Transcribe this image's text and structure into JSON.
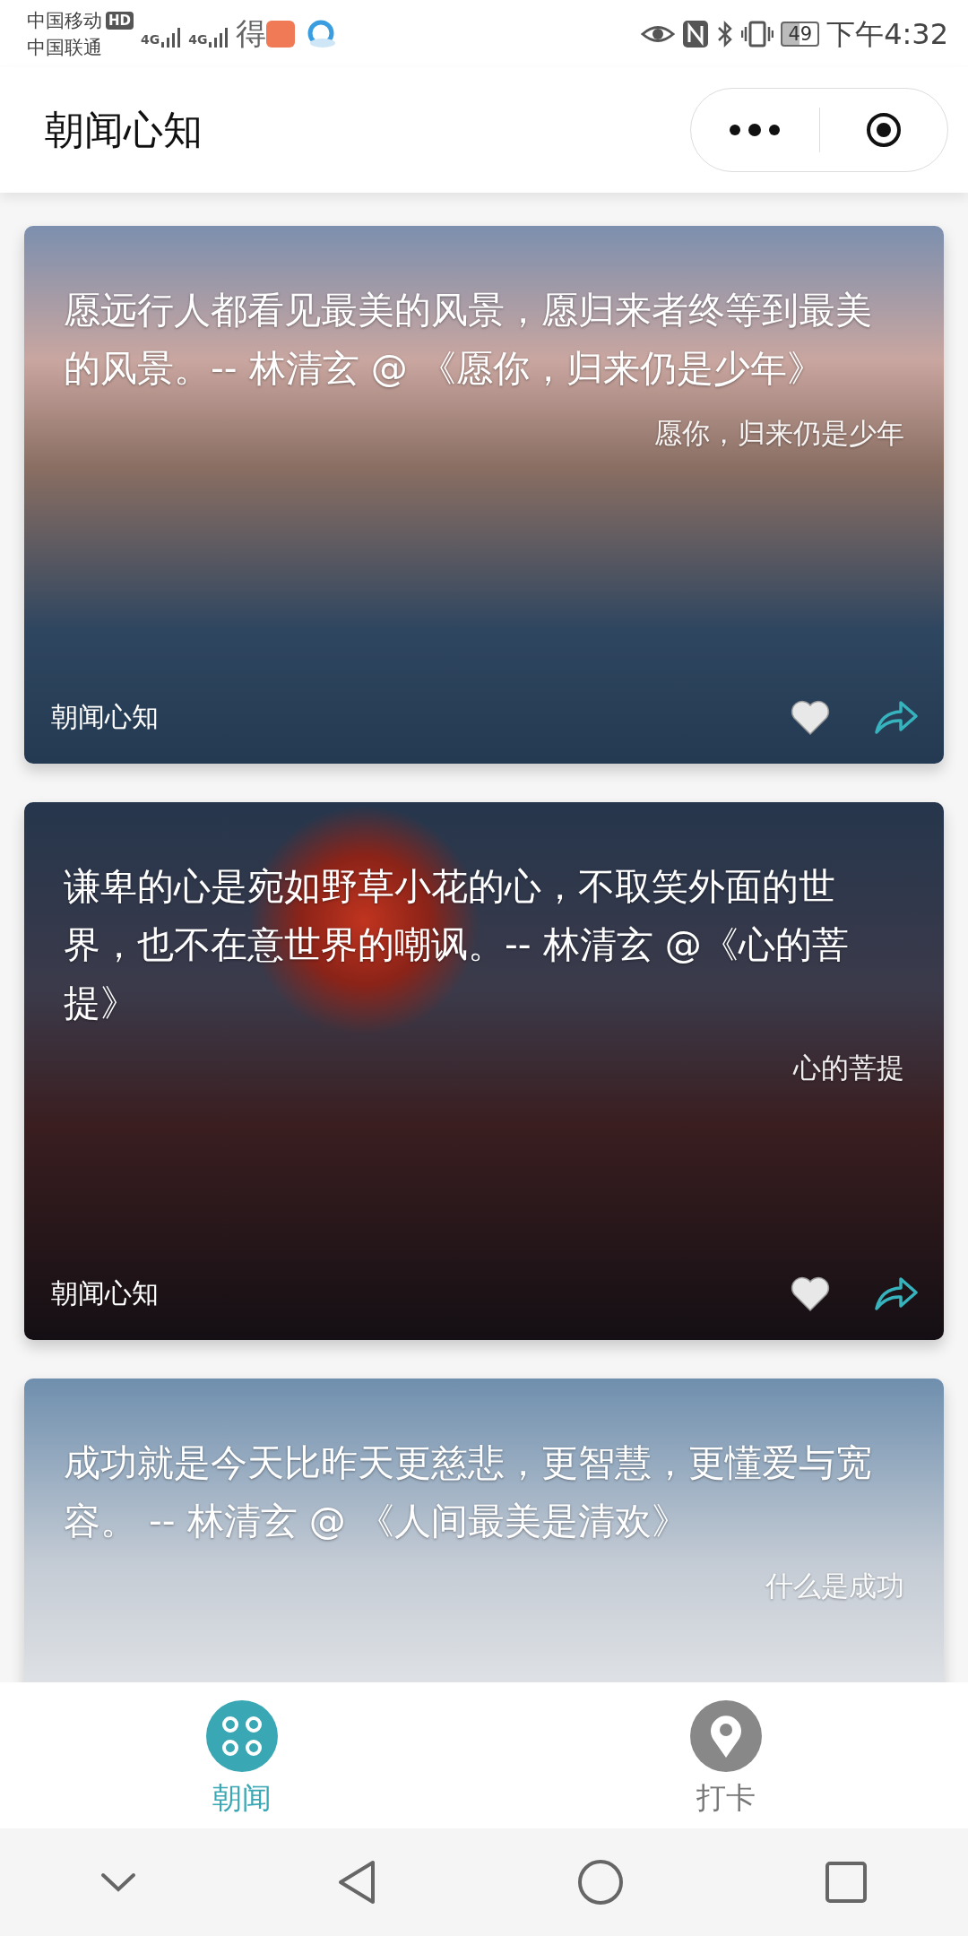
{
  "status_bar": {
    "carriers": [
      "中国移动",
      "中国联通"
    ],
    "hd_badge": "HD",
    "networks": [
      "4G",
      "4G"
    ],
    "app_glyph": "得",
    "battery": "49",
    "time": "下午4:32"
  },
  "header": {
    "title": "朝闻心知"
  },
  "cards": [
    {
      "quote": "愿远行人都看见最美的风景，愿归来者终等到最美的风景。-- 林清玄 @ 《愿你，归来仍是少年》",
      "subtitle": "愿你，归来仍是少年",
      "source": "朝闻心知",
      "liked": false,
      "kind": "sunset"
    },
    {
      "quote": "谦卑的心是宛如野草小花的心，不取笑外面的世界，也不在意世界的嘲讽。-- 林清玄 @《心的菩提》",
      "subtitle": "心的菩提",
      "source": "朝闻心知",
      "liked": false,
      "kind": "night"
    },
    {
      "quote": "成功就是今天比昨天更慈悲，更智慧，更懂爱与宽容。 -- 林清玄 @ 《人间最美是清欢》",
      "subtitle": "什么是成功",
      "kind": "sky"
    }
  ],
  "tabs": [
    {
      "label": "朝闻",
      "selected": true,
      "kind": "grid"
    },
    {
      "label": "打卡",
      "selected": false,
      "kind": "pin"
    }
  ]
}
